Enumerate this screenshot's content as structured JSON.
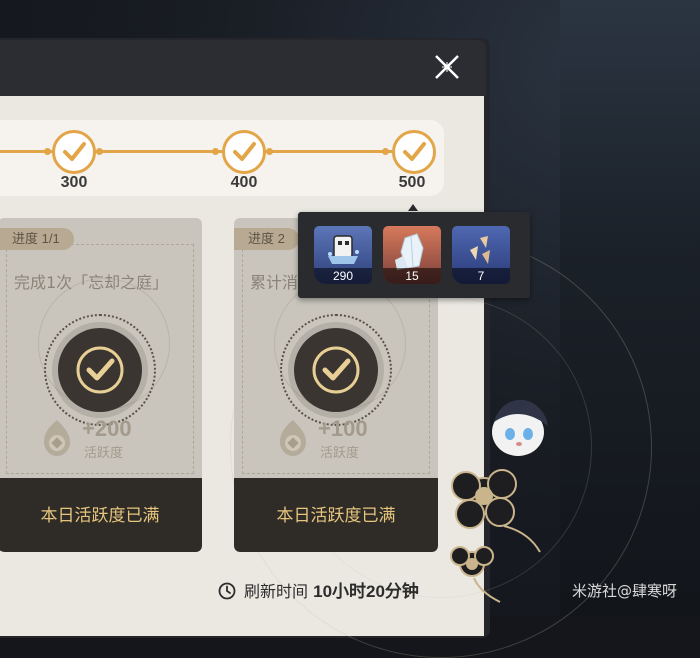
{
  "milestones": [
    {
      "label": "300"
    },
    {
      "label": "400"
    },
    {
      "label": "500"
    }
  ],
  "tasks": [
    {
      "progress": "进度  1/1",
      "description": "完成1次「忘却之庭」",
      "reward": "+200",
      "reward_label": "活跃度",
      "status": "本日活跃度已满"
    },
    {
      "progress": "进度  2",
      "description": "累计消",
      "reward": "+100",
      "reward_label": "活跃度",
      "status": "本日活跃度已满"
    }
  ],
  "refresh": {
    "prefix": "刷新时间",
    "value": "10小时20分钟"
  },
  "tooltip_rewards": [
    {
      "name": "credit-tile-icon",
      "count": "290"
    },
    {
      "name": "crystal-icon",
      "count": "15"
    },
    {
      "name": "shard-icon",
      "count": "7"
    }
  ],
  "watermark": "米游社@肆寒呀",
  "colors": {
    "accent": "#e2a547",
    "button_text": "#e6c57c",
    "button_bg": "#2f2c28"
  }
}
